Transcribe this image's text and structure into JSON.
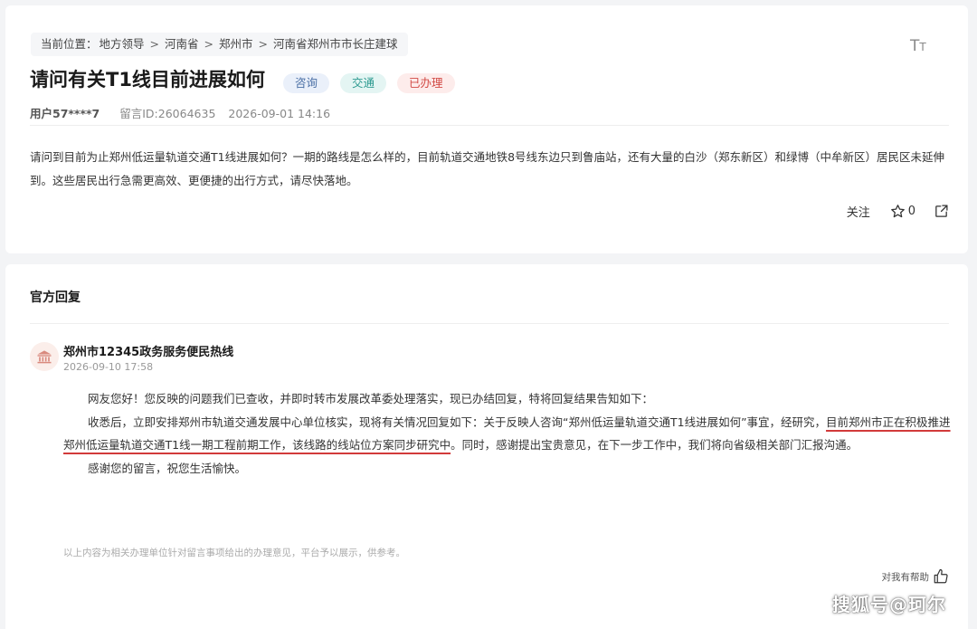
{
  "breadcrumb": {
    "prefix": "当前位置：",
    "items": [
      "地方领导",
      "河南省",
      "郑州市",
      "河南省郑州市市长庄建球"
    ]
  },
  "font_size_icon": "font-size-icon",
  "question": {
    "title": "请问有关T1线目前进展如何",
    "tags": [
      "咨询",
      "交通",
      "已办理"
    ],
    "user": "用户57****7",
    "message_id": "留言ID:26064635",
    "date": "2026-09-01 14:16",
    "body": "请问到目前为止郑州低运量轨道交通T1线进展如何？一期的路线是怎么样的，目前轨道交通地铁8号线东边只到鲁庙站，还有大量的白沙（郑东新区）和绿博（中牟新区）居民区未延伸到。这些居民出行急需更高效、更便捷的出行方式，请尽快落地。"
  },
  "actions": {
    "follow_label": "关注",
    "star_count": "0"
  },
  "reply": {
    "section_title": "官方回复",
    "org_name": "郑州市12345政务服务便民热线",
    "date": "2026-09-10 17:58",
    "p1": "网友您好！您反映的问题我们已查收，并即时转市发展改革委处理落实，现已办结回复，特将回复结果告知如下：",
    "p2_a": "收悉后，立即安排郑州市轨道交通发展中心单位核实，现将有关情况回复如下：关于反映人咨询“郑州低运量轨道交通T1线进展如何”事宜，经研究，",
    "p2_highlight": "目前郑州市正在积极推进郑州低运量轨道交通T1线一期工程前期工作，该线路的线站位方案同步研究中",
    "p2_b": "。同时，感谢提出宝贵意见，在下一步工作中，我们将向省级相关部门汇报沟通。",
    "p3": "感谢您的留言，祝您生活愉快。",
    "disclaimer": "以上内容为相关办理单位针对留言事项给出的办理意见，平台予以展示，供参考。",
    "helpful_label": "对我有帮助"
  },
  "watermark": "搜狐号@珂尔",
  "colors": {
    "accent_red": "#d23a3a",
    "tag_blue": "#4a6fa5",
    "tag_teal": "#2d9a90",
    "tag_red": "#d24a45"
  }
}
